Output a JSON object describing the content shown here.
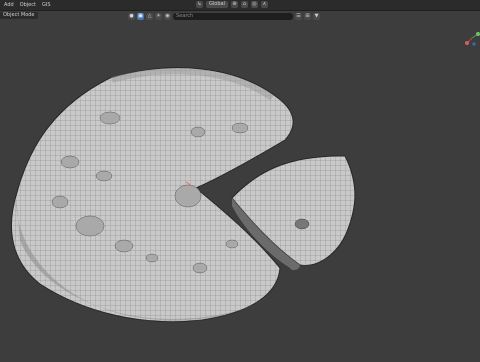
{
  "menu": {
    "items": [
      "Add",
      "Object",
      "GIS"
    ]
  },
  "header": {
    "transform_orientation": "Global",
    "mode_label": "Object Mode",
    "search_placeholder": "Search"
  },
  "colors": {
    "background": "#3d3d3d",
    "model": "#c9c9c9",
    "wire": "#6c6c6c",
    "accent": "#4772b3"
  }
}
